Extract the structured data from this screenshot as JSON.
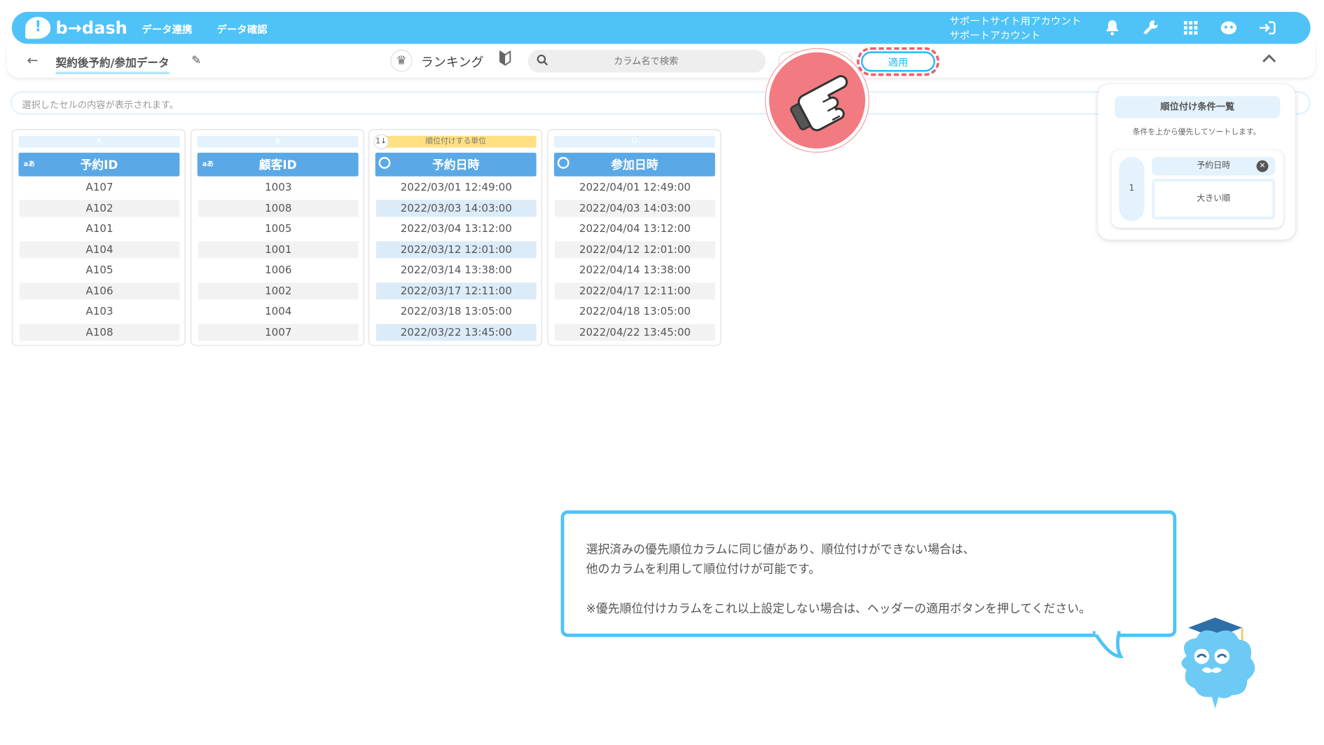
{
  "header": {
    "logo_text": "b→dash",
    "nav": [
      "データ連携",
      "データ確認"
    ],
    "account_line1": "サポートサイト用アカウント",
    "account_line2": "サポートアカウント",
    "icons": [
      "bell-icon",
      "wrench-icon",
      "grid-icon",
      "mascot-icon",
      "logout-icon"
    ]
  },
  "subbar": {
    "back_glyph": "←",
    "title": "契約後予約/参加データ",
    "ranking_label": "ランキング",
    "search_placeholder": "カラム名で検索",
    "apply_label": "適用",
    "collapse_glyph": "⌃"
  },
  "cell_display": "選択したセルの内容が表示されます。",
  "columns": [
    {
      "letter": "A",
      "header": "予約ID",
      "type_badge": "aあ",
      "cells": [
        "A107",
        "A102",
        "A101",
        "A104",
        "A105",
        "A106",
        "A103",
        "A108"
      ]
    },
    {
      "letter": "B",
      "header": "顧客ID",
      "type_badge": "aあ",
      "cells": [
        "1003",
        "1008",
        "1005",
        "1001",
        "1006",
        "1002",
        "1004",
        "1007"
      ]
    },
    {
      "letter": "順位付けする単位",
      "header": "予約日時",
      "sort_badge": "1↓",
      "cells": [
        "2022/03/01 12:49:00",
        "2022/03/03 14:03:00",
        "2022/03/04 13:12:00",
        "2022/03/12 12:01:00",
        "2022/03/14 13:38:00",
        "2022/03/17 12:11:00",
        "2022/03/18 13:05:00",
        "2022/03/22 13:45:00"
      ]
    },
    {
      "letter": "D",
      "header": "参加日時",
      "cells": [
        "2022/04/01 12:49:00",
        "2022/04/03 14:03:00",
        "2022/04/04 13:12:00",
        "2022/04/12 12:01:00",
        "2022/04/14 13:38:00",
        "2022/04/17 12:11:00",
        "2022/04/18 13:05:00",
        "2022/04/22 13:45:00"
      ]
    }
  ],
  "panel": {
    "title": "順位付け条件一覧",
    "description": "条件を上から優先してソートします。",
    "conditions": [
      {
        "number": "1",
        "column": "予約日時",
        "remove_glyph": "✕",
        "order": "大きい順"
      }
    ]
  },
  "callout": {
    "line1": "選択済みの優先順位カラムに同じ値があり、順位付けができない場合は、",
    "line2": "他のカラムを利用して順位付けが可能です。",
    "line3": "※優先順位付けカラムをこれ以上設定しない場合は、ヘッダーの適用ボタンを押してください。"
  },
  "colors": {
    "header": "#4fc3f7",
    "column_header": "#5aa9e6",
    "rank_highlight": "#ffe082",
    "apply_ring": "#ef5f6a",
    "pointer": "#f27b81"
  }
}
